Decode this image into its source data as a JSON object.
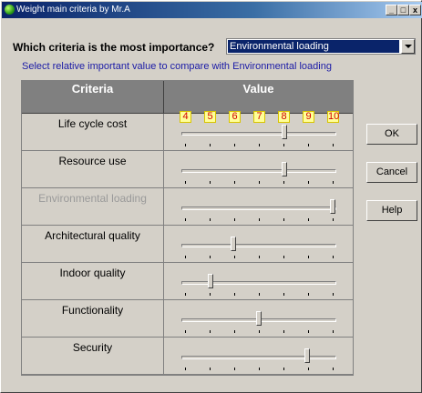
{
  "window": {
    "title": "Weight main criteria by Mr.A"
  },
  "controls": {
    "minimize": "_",
    "maximize": "□",
    "close": "x"
  },
  "question": "Which criteria is  the most importance?",
  "selector": {
    "value": "Environmental loading"
  },
  "instruction": "Select relative important value to compare with Environmental loading",
  "table": {
    "headers": {
      "criteria": "Criteria",
      "value": "Value"
    },
    "scale_labels": [
      "4",
      "5",
      "6",
      "7",
      "8",
      "9",
      "10"
    ],
    "rows": [
      {
        "label": "Life cycle cost",
        "value": 0.67,
        "disabled": false
      },
      {
        "label": "Resource use",
        "value": 0.67,
        "disabled": false
      },
      {
        "label": "Environmental loading",
        "value": 1.0,
        "disabled": true
      },
      {
        "label": "Architectural quality",
        "value": 0.33,
        "disabled": false
      },
      {
        "label": "Indoor quality",
        "value": 0.17,
        "disabled": false
      },
      {
        "label": "Functionality",
        "value": 0.5,
        "disabled": false
      },
      {
        "label": "Security",
        "value": 0.83,
        "disabled": false
      }
    ]
  },
  "buttons": {
    "ok": "OK",
    "cancel": "Cancel",
    "help": "Help"
  }
}
